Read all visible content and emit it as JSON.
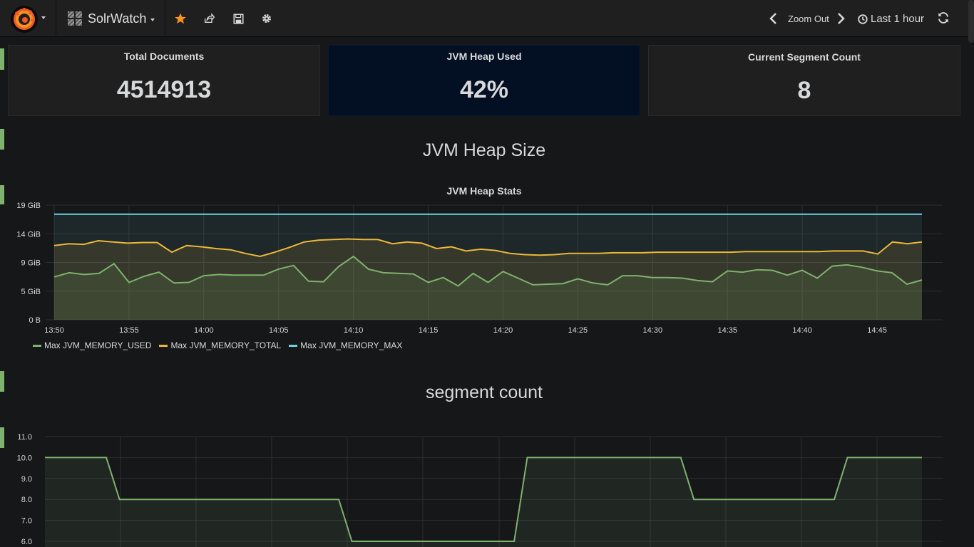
{
  "header": {
    "dashboard_title": "SolrWatch",
    "zoom_out_label": "Zoom Out",
    "time_range_label": "Last 1 hour",
    "icons": [
      "grafana-logo-icon",
      "star-icon",
      "share-icon",
      "save-icon",
      "gear-icon",
      "chevron-left-icon",
      "chevron-right-icon",
      "clock-icon",
      "refresh-icon"
    ]
  },
  "stats": [
    {
      "title": "Total Documents",
      "value": "4514913"
    },
    {
      "title": "JVM Heap Used",
      "value": "42%"
    },
    {
      "title": "Current Segment Count",
      "value": "8"
    }
  ],
  "rows": {
    "jvm_heap_size_title": "JVM Heap Size",
    "segment_count_title": "segment count"
  },
  "colors": {
    "used": "#7eb26d",
    "total": "#eab839",
    "max": "#6ed0e0",
    "accent_star": "#f79520"
  },
  "chart_data": [
    {
      "type": "line",
      "title": "JVM Heap Stats",
      "y_unit": "GiB",
      "ylim": [
        0,
        19
      ],
      "y_ticks": [
        "0 B",
        "5 GiB",
        "9 GiB",
        "14 GiB",
        "19 GiB"
      ],
      "y_tick_values": [
        0,
        4.75,
        9.5,
        14.25,
        19
      ],
      "x_ticks": [
        "13:50",
        "13:55",
        "14:00",
        "14:05",
        "14:10",
        "14:15",
        "14:20",
        "14:25",
        "14:30",
        "14:35",
        "14:40",
        "14:45"
      ],
      "x_start": "13:50",
      "x_end": "14:48",
      "series": [
        {
          "name": "Max JVM_MEMORY_USED",
          "color": "#7eb26d",
          "values": [
            7.1,
            7.8,
            7.5,
            7.7,
            9.3,
            6.2,
            7.2,
            7.9,
            6.1,
            6.2,
            7.3,
            7.5,
            7.4,
            7.4,
            7.4,
            8.4,
            9.0,
            6.4,
            6.3,
            8.8,
            10.5,
            8.4,
            7.8,
            7.7,
            7.6,
            6.2,
            7.0,
            5.6,
            7.7,
            6.2,
            8.0,
            6.9,
            5.8,
            5.9,
            6.0,
            6.8,
            6.1,
            5.8,
            7.3,
            7.3,
            7.0,
            7.0,
            6.9,
            6.5,
            6.3,
            8.1,
            7.9,
            8.3,
            8.2,
            7.4,
            8.2,
            6.9,
            8.9,
            9.1,
            8.7,
            8.1,
            7.8,
            5.9,
            6.6
          ]
        },
        {
          "name": "Max JVM_MEMORY_TOTAL",
          "color": "#eab839",
          "values": [
            12.3,
            12.6,
            12.5,
            13.1,
            12.9,
            12.7,
            12.8,
            12.8,
            11.2,
            12.3,
            12.1,
            11.8,
            11.6,
            11.0,
            10.5,
            11.2,
            12.0,
            12.9,
            13.2,
            13.3,
            13.4,
            13.3,
            13.3,
            12.6,
            12.9,
            12.7,
            11.8,
            12.1,
            11.4,
            11.7,
            11.5,
            11.0,
            10.8,
            10.7,
            10.8,
            11.0,
            11.0,
            11.0,
            11.1,
            11.1,
            11.1,
            11.2,
            11.2,
            11.2,
            11.2,
            11.2,
            11.2,
            11.3,
            11.3,
            11.3,
            11.3,
            11.3,
            11.3,
            11.4,
            11.4,
            11.4,
            10.9,
            12.9,
            12.6,
            12.9
          ]
        },
        {
          "name": "Max JVM_MEMORY_MAX",
          "color": "#6ed0e0",
          "values": [
            17.5,
            17.5
          ]
        }
      ]
    },
    {
      "type": "line",
      "title": "",
      "ylim": [
        6,
        11
      ],
      "y_ticks": [
        "6.0",
        "7.0",
        "8.0",
        "9.0",
        "10.0",
        "11.0"
      ],
      "series": [
        {
          "name": "",
          "color": "#7eb26d",
          "points": [
            [
              0,
              10
            ],
            [
              0.07,
              10
            ],
            [
              0.085,
              8
            ],
            [
              0.335,
              8
            ],
            [
              0.35,
              6
            ],
            [
              0.535,
              6
            ],
            [
              0.55,
              10
            ],
            [
              0.725,
              10
            ],
            [
              0.74,
              8
            ],
            [
              0.9,
              8
            ],
            [
              0.915,
              10
            ],
            [
              1,
              10
            ]
          ]
        }
      ]
    }
  ]
}
